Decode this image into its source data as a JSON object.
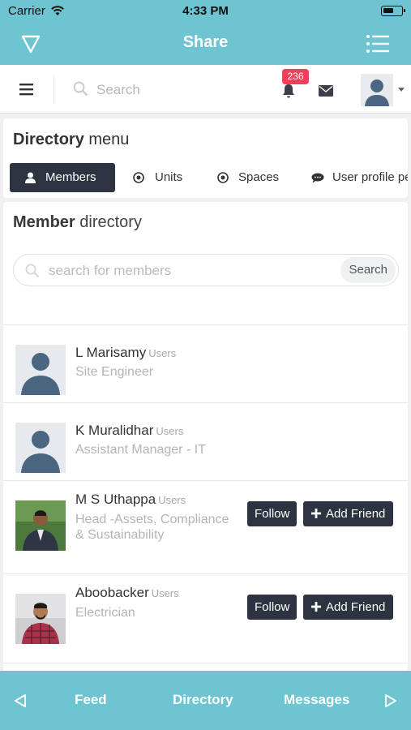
{
  "status_bar": {
    "carrier": "Carrier",
    "time": "4:33 PM"
  },
  "nav_bar": {
    "title": "Share"
  },
  "toolbar": {
    "search_placeholder": "Search",
    "notification_count": "236"
  },
  "directory_menu": {
    "heading_bold": "Directory",
    "heading_rest": " menu",
    "tabs": [
      {
        "label": "Members",
        "icon": "user-icon",
        "active": true
      },
      {
        "label": "Units",
        "icon": "radio-dot-icon",
        "active": false
      },
      {
        "label": "Spaces",
        "icon": "radio-dot-icon",
        "active": false
      },
      {
        "label": "User profile pe",
        "icon": "chat-bubble-icon",
        "active": false
      }
    ]
  },
  "member_directory": {
    "heading_bold": "Member",
    "heading_rest": " directory",
    "search_placeholder": "search for members",
    "search_button": "Search",
    "members": [
      {
        "name": "L Marisamy",
        "role": "Users",
        "title_lines": [
          "Site Engineer"
        ],
        "photo": "default-avatar",
        "actions": false
      },
      {
        "name": "K Muralidhar",
        "role": "Users",
        "title_lines": [
          "Assistant Manager - IT"
        ],
        "photo": "default-avatar",
        "actions": false
      },
      {
        "name": "M S Uthappa",
        "role": "Users",
        "title_lines": [
          "Head -Assets, Compliance",
          "& Sustainability"
        ],
        "photo": "photo",
        "actions": true
      },
      {
        "name": "Aboobacker",
        "role": "Users",
        "title_lines": [
          "Electrician"
        ],
        "photo": "photo",
        "actions": true
      }
    ],
    "follow_label": "Follow",
    "add_friend_label": "Add Friend"
  },
  "bottom_bar": {
    "items": [
      "Feed",
      "Directory",
      "Messages"
    ]
  },
  "colors": {
    "accent": "#6fc4d2",
    "dark_button": "#2d3340",
    "badge": "#ee3f5b"
  }
}
